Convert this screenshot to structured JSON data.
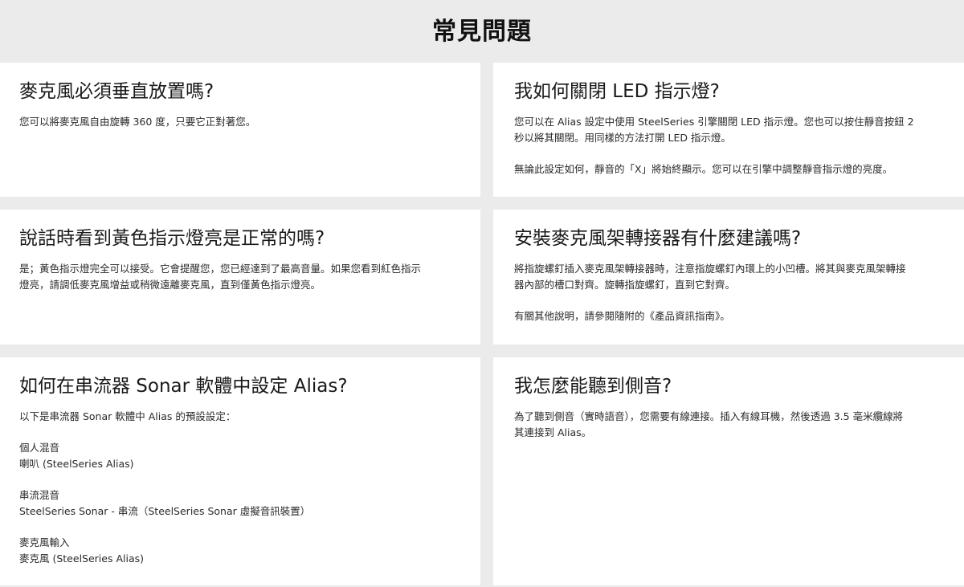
{
  "page": {
    "title": "常見問題"
  },
  "faq": [
    {
      "question": "麥克風必須垂直放置嗎?",
      "paragraphs": [
        "您可以將麥克風自由旋轉 360 度，只要它正對著您。"
      ]
    },
    {
      "question": "我如何關閉 LED 指示燈?",
      "paragraphs": [
        "您可以在 Alias 設定中使用 SteelSeries 引擎關閉 LED 指示燈。您也可以按住靜音按鈕 2\n秒以將其關閉。用同樣的方法打開 LED 指示燈。",
        "無論此設定如何，靜音的「X」將始終顯示。您可以在引擎中調整靜音指示燈的亮度。"
      ]
    },
    {
      "question": "說話時看到黃色指示燈亮是正常的嗎?",
      "paragraphs": [
        "是；黃色指示燈完全可以接受。它會提醒您，您已經達到了最高音量。如果您看到紅色指示\n燈亮，請調低麥克風增益或稍微遠離麥克風，直到僅黃色指示燈亮。"
      ]
    },
    {
      "question": "安裝麥克風架轉接器有什麼建議嗎?",
      "paragraphs": [
        "將指旋螺釘插入麥克風架轉接器時，注意指旋螺釘內環上的小凹槽。將其與麥克風架轉接\n器內部的槽口對齊。旋轉指旋螺釘，直到它對齊。",
        "有關其他說明，請參閱隨附的《產品資訊指南》。"
      ]
    },
    {
      "question": "如何在串流器 Sonar 軟體中設定 Alias?",
      "paragraphs": [
        "以下是串流器 Sonar 軟體中 Alias 的預設設定：",
        "個人混音\n喇叭 (SteelSeries Alias)",
        "串流混音\nSteelSeries Sonar - 串流（SteelSeries Sonar 虛擬音訊裝置）",
        "麥克風輸入\n麥克風 (SteelSeries Alias)"
      ]
    },
    {
      "question": "我怎麼能聽到側音?",
      "paragraphs": [
        "為了聽到側音（實時語音），您需要有線連接。插入有線耳機，然後透過 3.5 毫米纜線將\n其連接到 Alias。"
      ]
    }
  ]
}
